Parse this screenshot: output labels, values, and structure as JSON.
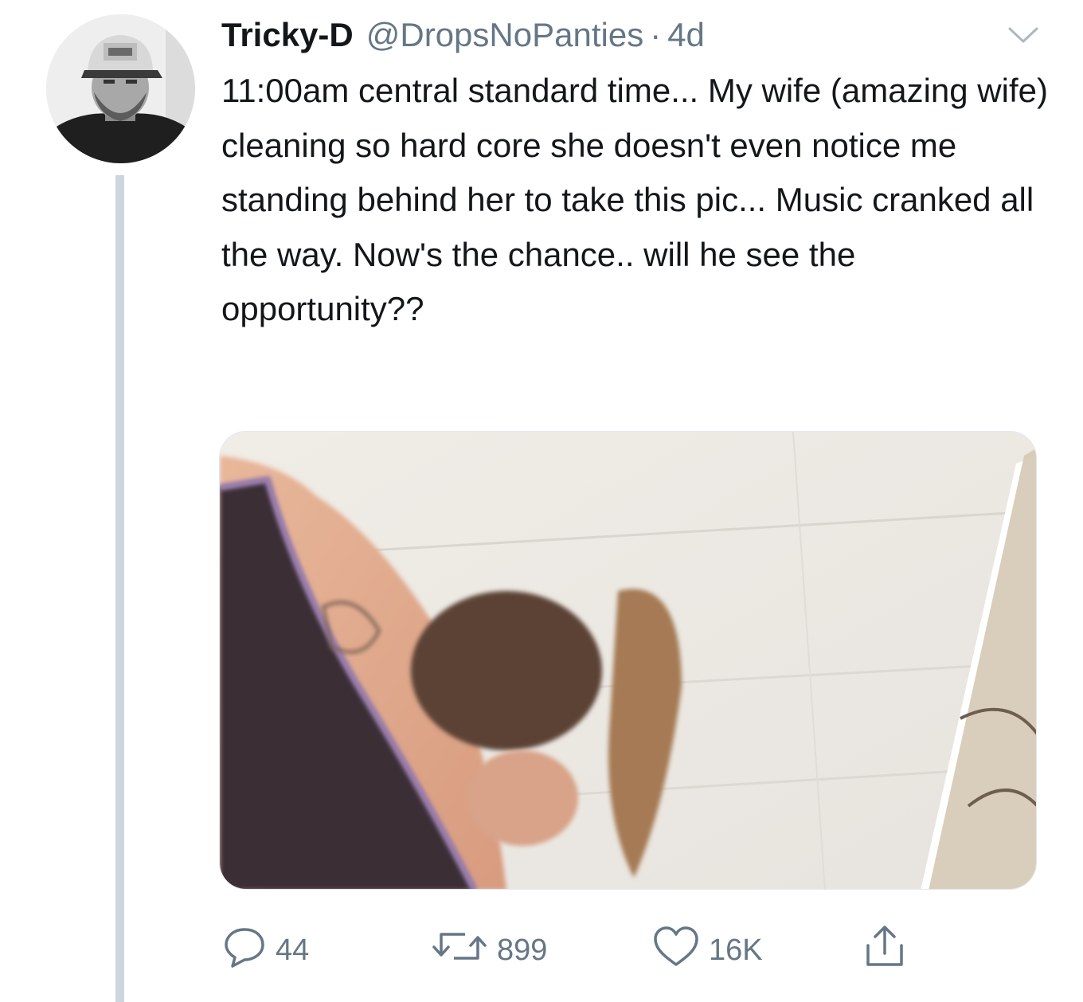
{
  "tweet": {
    "display_name": "Tricky-D",
    "handle": "@DropsNoPanties",
    "separator": "·",
    "time": "4d",
    "text": "11:00am central standard time... My wife (amazing wife) cleaning so hard core she doesn't even notice me standing behind her to take this pic... Music cranked all the way. Now's the chance.. will he see the opportunity??",
    "icons": {
      "more": "chevron-down-icon",
      "reply": "reply-icon",
      "retweet": "retweet-icon",
      "like": "heart-icon",
      "share": "share-icon"
    },
    "actions": {
      "replies": "44",
      "retweets": "899",
      "likes": "16K"
    }
  },
  "colors": {
    "text": "#14171a",
    "secondary": "#657786",
    "thread_line": "#ccd6dd"
  }
}
